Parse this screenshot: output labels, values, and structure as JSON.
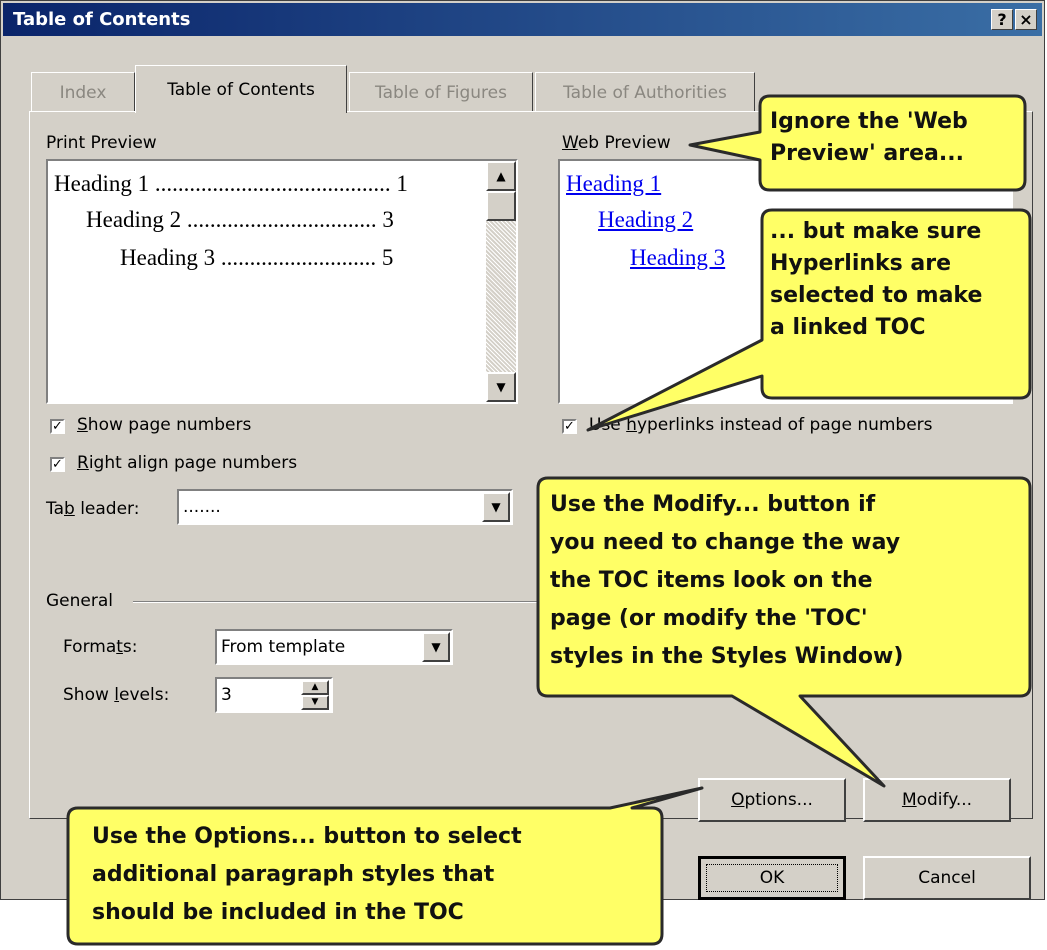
{
  "window": {
    "title": "Table of Contents",
    "help_glyph": "?",
    "close_glyph": "×"
  },
  "tabs": [
    {
      "label": "Index",
      "active": false
    },
    {
      "label": "Table of Contents",
      "active": true
    },
    {
      "label": "Table of Figures",
      "active": false
    },
    {
      "label": "Table of Authorities",
      "active": false
    }
  ],
  "print_preview": {
    "label": "Print Preview",
    "lines": [
      {
        "text": "Heading 1",
        "page": "1"
      },
      {
        "text": "Heading 2",
        "page": "3"
      },
      {
        "text": "Heading 3",
        "page": "5"
      }
    ]
  },
  "web_preview": {
    "label": "Web Preview",
    "lines": [
      "Heading 1",
      "Heading 2",
      "Heading 3"
    ]
  },
  "options": {
    "show_page_numbers": {
      "label": "Show page numbers",
      "checked": true
    },
    "right_align_page_numbers": {
      "label": "Right align page numbers",
      "checked": true
    },
    "use_hyperlinks": {
      "label": "Use hyperlinks instead of page numbers",
      "checked": true
    },
    "tab_leader": {
      "label": "Tab leader:",
      "value": "......."
    }
  },
  "general": {
    "label": "General",
    "formats": {
      "label": "Formats:",
      "value": "From template"
    },
    "show_levels": {
      "label": "Show levels:",
      "value": "3"
    }
  },
  "buttons": {
    "options": "Options...",
    "modify": "Modify...",
    "ok": "OK",
    "cancel": "Cancel"
  },
  "callouts": {
    "web_preview_note": [
      "Ignore the 'Web",
      "Preview' area..."
    ],
    "hyperlinks_note": [
      "... but make sure",
      "Hyperlinks are",
      "selected to make",
      "a linked TOC"
    ],
    "modify_note": [
      "Use the Modify... button if",
      "you need to change the way",
      "the TOC items look on the",
      "page (or modify the 'TOC'",
      "styles in the Styles Window)"
    ],
    "options_note": [
      "Use the Options... button to select",
      "additional paragraph styles that",
      "should be included in the TOC"
    ]
  },
  "colors": {
    "dialog_bg": "#d4d0c8",
    "title_bar": "#0a246a",
    "callout_fill": "#ffff66",
    "link": "#0000ee"
  }
}
